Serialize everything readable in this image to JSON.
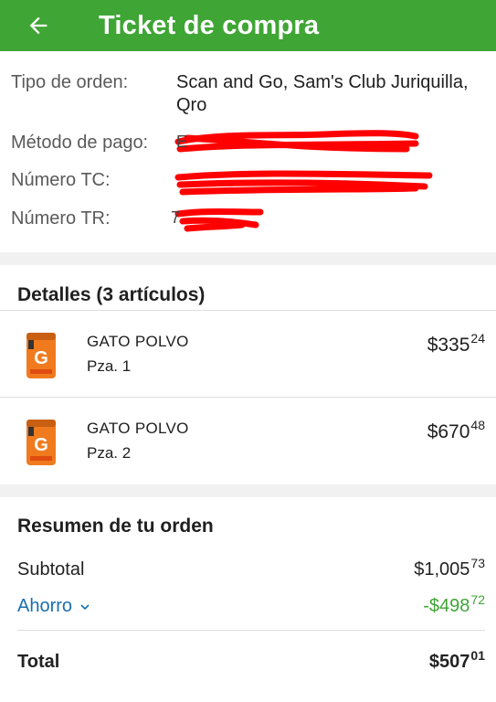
{
  "colors": {
    "brand_green": "#3fa535",
    "link_blue": "#1a6fb0",
    "savings_green": "#3fa535",
    "redaction_red": "#ff0000"
  },
  "header": {
    "title": "Ticket de compra",
    "back_icon": "arrow-left-icon"
  },
  "order_info": {
    "tipo_orden_label": "Tipo de orden:",
    "tipo_orden_value_line1": "Scan and Go, Sam's Club Juriquilla,",
    "tipo_orden_value_line2": "Qro",
    "metodo_pago_label": "Método de pago:",
    "numero_tc_label": "Número TC:",
    "numero_tr_label": "Número TR:",
    "redaction_note": "values obscured by red scribbles"
  },
  "details": {
    "title": "Detalles (3 artículos)",
    "items": [
      {
        "name": "GATO POLVO",
        "qty": "Pza. 1",
        "price_main": "$335",
        "price_cents": "24",
        "thumb": "gatorade-powder-tub"
      },
      {
        "name": "GATO POLVO",
        "qty": "Pza. 2",
        "price_main": "$670",
        "price_cents": "48",
        "thumb": "gatorade-powder-tub"
      }
    ]
  },
  "summary": {
    "title": "Resumen de tu orden",
    "subtotal_label": "Subtotal",
    "subtotal_main": "$1,005",
    "subtotal_cents": "73",
    "ahorro_label": "Ahorro",
    "ahorro_main": "-$498",
    "ahorro_cents": "72",
    "total_label": "Total",
    "total_main": "$507",
    "total_cents": "01"
  }
}
